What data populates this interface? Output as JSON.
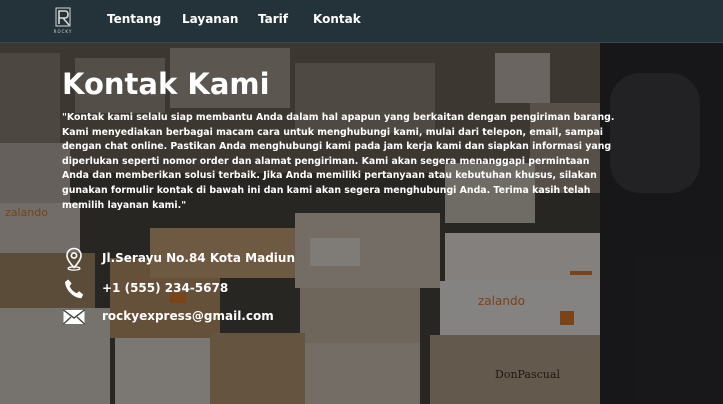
{
  "brand": {
    "logo_text": "ROCKY"
  },
  "nav": {
    "items": [
      {
        "label": "Tentang"
      },
      {
        "label": "Layanan"
      },
      {
        "label": "Tarif"
      },
      {
        "label": "Kontak"
      }
    ]
  },
  "hero": {
    "title": "Kontak Kami",
    "description": "\"Kontak kami selalu siap membantu Anda dalam hal apapun yang berkaitan dengan pengiriman barang. Kami menyediakan berbagai macam cara untuk menghubungi kami, mulai dari telepon, email, sampai dengan chat online. Pastikan Anda menghubungi kami pada jam kerja kami dan siapkan informasi yang diperlukan seperti nomor order dan alamat pengiriman. Kami akan segera menanggapi permintaan Anda dan memberikan solusi terbaik. Jika Anda memiliki pertanyaan atau kebutuhan khusus, silakan gunakan formulir kontak di bawah ini dan kami akan segera menghubungi Anda. Terima kasih telah memilih layanan kami.\"",
    "background_text": [
      "zalando",
      "zalando",
      "DonPascual"
    ]
  },
  "contact": {
    "address": "Jl.Serayu No.84 Kota Madiun",
    "phone": "+1 (555) 234-5678",
    "email": "rockyexpress@gmail.com"
  },
  "colors": {
    "navbar": "#24323a",
    "text": "#ffffff"
  }
}
